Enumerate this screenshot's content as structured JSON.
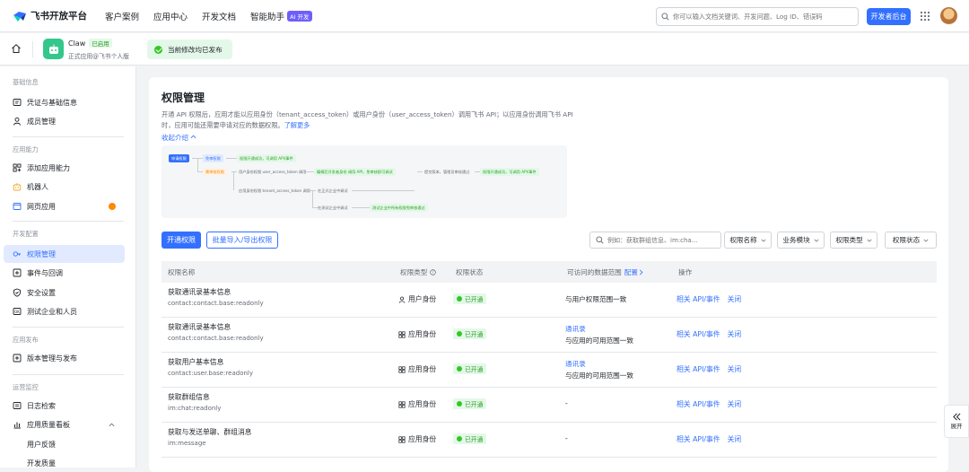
{
  "header": {
    "logo_text": "飞书开放平台",
    "nav": [
      "客户案例",
      "应用中心",
      "开发文档",
      "智能助手"
    ],
    "ai_badge": "AI 开发",
    "search_placeholder": "你可以输入文档关键词、开发问题、Log ID、错误码",
    "dev_console_label": "开发者后台"
  },
  "app": {
    "name": "Claw",
    "status_tag": "已启用",
    "subtitle": "正式应用@飞书个人版",
    "publish_status": "当前修改均已发布"
  },
  "sidebar": {
    "sections": [
      {
        "title": "基础信息",
        "items": [
          "凭证与基础信息",
          "成员管理"
        ]
      },
      {
        "title": "应用能力",
        "items": [
          "添加应用能力",
          "机器人",
          "网页应用"
        ]
      },
      {
        "title": "开发配置",
        "items": [
          "权限管理",
          "事件与回调",
          "安全设置",
          "测试企业和人员"
        ]
      },
      {
        "title": "应用发布",
        "items": [
          "版本管理与发布"
        ]
      },
      {
        "title": "运营监控",
        "items": [
          "日志检索",
          "应用质量看板",
          "用户反馈",
          "开发质量"
        ]
      }
    ],
    "active": "权限管理"
  },
  "page": {
    "title": "权限管理",
    "description": "开通 API 权限后，应用才能以应用身份（tenant_access_token）或用户身份（user_access_token）调用飞书 API；以应用身份调用飞书 API 时，应用可能还需要申请对应的数据权限。",
    "learn_more": "了解更多",
    "collapse_label": "收起介绍",
    "flow": {
      "start": "申请权限",
      "n1": "免审权限",
      "n1_result": "权限开通成功，可调用 API/事件",
      "n2": "需审核权限",
      "n2a": "用户身份权限 user_access_token 调用",
      "n2a_mid": "编辑后开发者身份 调用 API，免审核即可调试",
      "n2a_pub": "提交版本，管理员审核通过",
      "n2a_result": "权限开通成功，可调用 API/事件",
      "n2b": "应用身份权限 tenant_access_token 调用",
      "n2b_1": "在正式企业中调试",
      "n2b_2": "在测试企业中调试",
      "n2b_3": "测试企业中所有权限免审核通过"
    },
    "open_button": "开通权限",
    "batch_button": "批量导入/导出权限",
    "filter_placeholder": "例如：获取群组信息、im:cha...",
    "filters": [
      "权限名称",
      "业务模块",
      "权限类型",
      "权限状态"
    ]
  },
  "table": {
    "headers": {
      "name": "权限名称",
      "type": "权限类型",
      "status": "权限状态",
      "range": "可访问的数据范围",
      "range_link": "配置",
      "ops": "操作"
    },
    "rows": [
      {
        "name": "获取通讯录基本信息",
        "scope": "contact:contact.base:readonly",
        "type": "用户身份",
        "type_icon": "user-icon",
        "status": "已开通",
        "range_link": "",
        "range": "与用户权限范围一致"
      },
      {
        "name": "获取通讯录基本信息",
        "scope": "contact:contact.base:readonly",
        "type": "应用身份",
        "type_icon": "app-icon",
        "status": "已开通",
        "range_link": "通讯录",
        "range": "与应用的可用范围一致"
      },
      {
        "name": "获取用户基本信息",
        "scope": "contact:user.base:readonly",
        "type": "应用身份",
        "type_icon": "app-icon",
        "status": "已开通",
        "range_link": "通讯录",
        "range": "与应用的可用范围一致"
      },
      {
        "name": "获取群组信息",
        "scope": "im:chat:readonly",
        "type": "应用身份",
        "type_icon": "app-icon",
        "status": "已开通",
        "range_link": "",
        "range": "-"
      },
      {
        "name": "获取与发送单聊、群组消息",
        "scope": "im:message",
        "type": "应用身份",
        "type_icon": "app-icon",
        "status": "已开通",
        "range_link": "",
        "range": "-"
      }
    ],
    "op_api": "相关 API/事件",
    "op_close": "关闭"
  },
  "float_button": "展开"
}
